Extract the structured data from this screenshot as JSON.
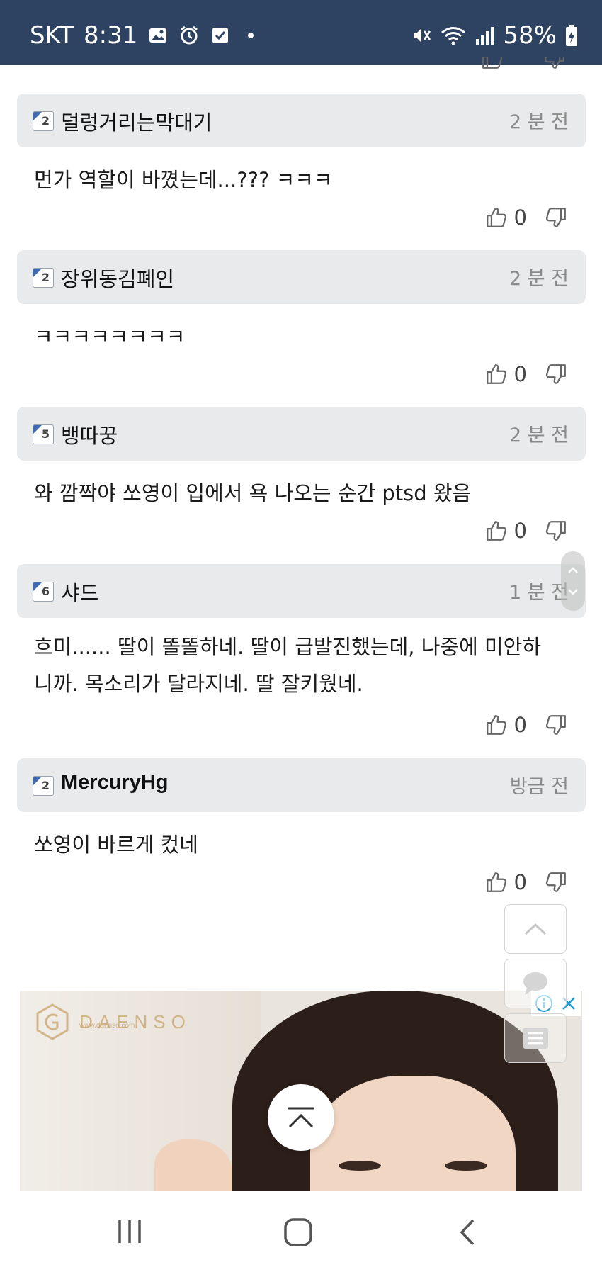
{
  "status_bar": {
    "carrier": "SKT",
    "time": "8:31",
    "battery": "58%",
    "left_icons": [
      "gallery-icon",
      "alarm-icon",
      "checkbox-icon"
    ],
    "right_icons": [
      "mute-icon",
      "wifi-icon",
      "signal-icon",
      "battery-charging-icon"
    ]
  },
  "comments": [
    {
      "level": "2",
      "nickname": "덜렁거리는막대기",
      "time": "2 분 전",
      "body_lines": [
        "먼가 역할이 바꼈는데...??? ㅋㅋㅋ"
      ],
      "likes": "0"
    },
    {
      "level": "2",
      "nickname": "장위동김폐인",
      "time": "2 분 전",
      "body_lines": [
        "ㅋㅋㅋㅋㅋㅋㅋㅋ"
      ],
      "likes": "0"
    },
    {
      "level": "5",
      "nickname": "뱅따꿍",
      "time": "2 분 전",
      "body_lines": [
        "와 깜짝야 쏘영이 입에서 욕 나오는 순간 ptsd 왔음"
      ],
      "likes": "0"
    },
    {
      "level": "6",
      "nickname": "샤드",
      "time": "1 분 전",
      "body_lines": [
        "흐미...... 딸이 똘똘하네. 딸이 급발진했는데, 나중에 미안하",
        "니까. 목소리가 달라지네. 딸 잘키웠네."
      ],
      "likes": "0"
    },
    {
      "level": "2",
      "nickname": "MercuryHg",
      "time": "방금 전",
      "body_lines": [
        "쏘영이 바르게 컸네"
      ],
      "likes": "0"
    }
  ],
  "ad": {
    "brand": "DAENSO",
    "brand_sub": "www.daenso.com"
  },
  "colors": {
    "status_bar": "#2e4261",
    "comment_header": "#e9eaec",
    "level_badge_accent": "#3d6bb3",
    "ad_choices_accent": "#1a9bd7"
  }
}
